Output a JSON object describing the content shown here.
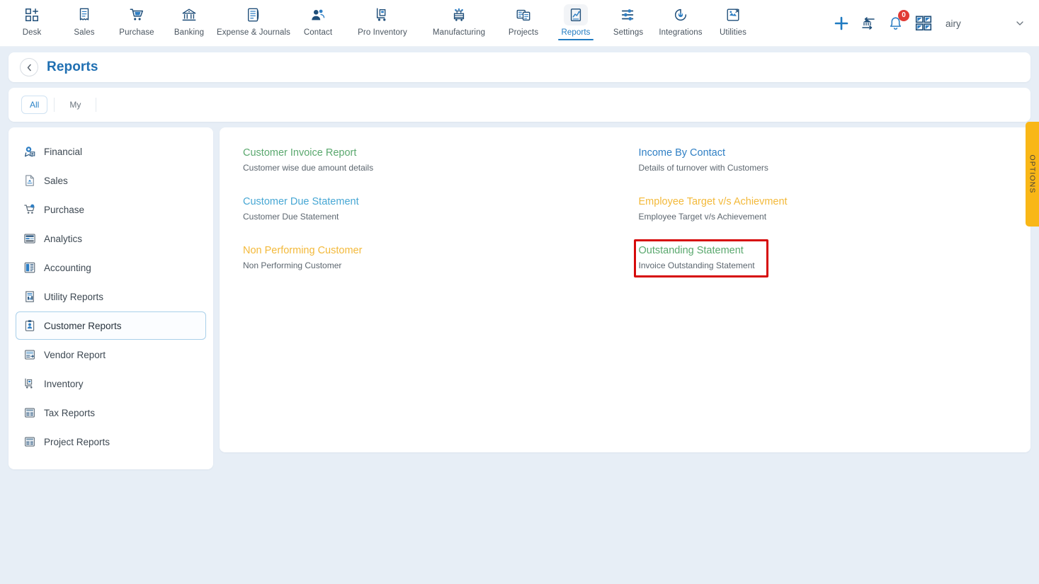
{
  "topnav": {
    "items": [
      {
        "label": "Desk",
        "icon": "dashboard-icon",
        "active": false
      },
      {
        "label": "Sales",
        "icon": "receipt-icon",
        "active": false
      },
      {
        "label": "Purchase",
        "icon": "cart-icon",
        "active": false
      },
      {
        "label": "Banking",
        "icon": "bank-icon",
        "active": false
      },
      {
        "label": "Expense & Journals",
        "icon": "journal-icon",
        "active": false
      },
      {
        "label": "Contact",
        "icon": "contacts-icon",
        "active": false
      },
      {
        "label": "Pro Inventory",
        "icon": "hand-truck-icon",
        "active": false
      },
      {
        "label": "Manufacturing",
        "icon": "manufacturing-icon",
        "active": false
      },
      {
        "label": "Projects",
        "icon": "projects-icon",
        "active": false
      },
      {
        "label": "Reports",
        "icon": "reports-icon",
        "active": true
      },
      {
        "label": "Settings",
        "icon": "sliders-icon",
        "active": false
      },
      {
        "label": "Integrations",
        "icon": "plug-icon",
        "active": false
      },
      {
        "label": "Utilities",
        "icon": "utilities-icon",
        "active": false
      }
    ],
    "right": {
      "add_label": "add-icon",
      "transfer_label": "bank-transfer-icon",
      "notifications_count": "0",
      "apps_label": "apps-grid-icon",
      "company": "airy",
      "caret": "chevron-down-icon"
    }
  },
  "page": {
    "back": "back-chevron-icon",
    "title": "Reports"
  },
  "filters": {
    "tabs": [
      {
        "label": "All",
        "selected": true
      },
      {
        "label": "My",
        "selected": false
      }
    ]
  },
  "sidebar": {
    "items": [
      {
        "label": "Financial",
        "icon": "financial-icon",
        "selected": false
      },
      {
        "label": "Sales",
        "icon": "sales-doc-icon",
        "selected": false
      },
      {
        "label": "Purchase",
        "icon": "purchase-cart-icon",
        "selected": false
      },
      {
        "label": "Analytics",
        "icon": "analytics-icon",
        "selected": false
      },
      {
        "label": "Accounting",
        "icon": "accounting-icon",
        "selected": false
      },
      {
        "label": "Utility Reports",
        "icon": "utility-report-icon",
        "selected": false
      },
      {
        "label": "Customer Reports",
        "icon": "customer-report-icon",
        "selected": true
      },
      {
        "label": "Vendor Report",
        "icon": "vendor-report-icon",
        "selected": false
      },
      {
        "label": "Inventory",
        "icon": "inventory-icon",
        "selected": false
      },
      {
        "label": "Tax Reports",
        "icon": "tax-report-icon",
        "selected": false
      },
      {
        "label": "Project Reports",
        "icon": "project-report-icon",
        "selected": false
      }
    ]
  },
  "reports": {
    "left": [
      {
        "title": "Customer Invoice Report",
        "desc": "Customer wise due amount details",
        "color": "#5aa86e",
        "highlighted": false
      },
      {
        "title": "Customer Due Statement",
        "desc": "Customer Due Statement",
        "color": "#47a7d4",
        "highlighted": false
      },
      {
        "title": "Non Performing Customer",
        "desc": "Non Performing Customer",
        "color": "#f3b93a",
        "highlighted": false
      }
    ],
    "right": [
      {
        "title": "Income By Contact",
        "desc": "Details of turnover with Customers",
        "color": "#2f7fc4",
        "highlighted": false
      },
      {
        "title": "Employee Target v/s Achievment",
        "desc": "Employee Target v/s Achievement",
        "color": "#f3b93a",
        "highlighted": false
      },
      {
        "title": "Outstanding Statement",
        "desc": "Invoice Outstanding Statement",
        "color": "#5aa86e",
        "highlighted": true
      }
    ]
  },
  "options_tab": {
    "label": "OPTIONS",
    "color": "#f9b717"
  },
  "colors": {
    "page_background": "#e7eef6",
    "accent_blue": "#1f7ac1",
    "highlight_red": "#d60a0a"
  }
}
